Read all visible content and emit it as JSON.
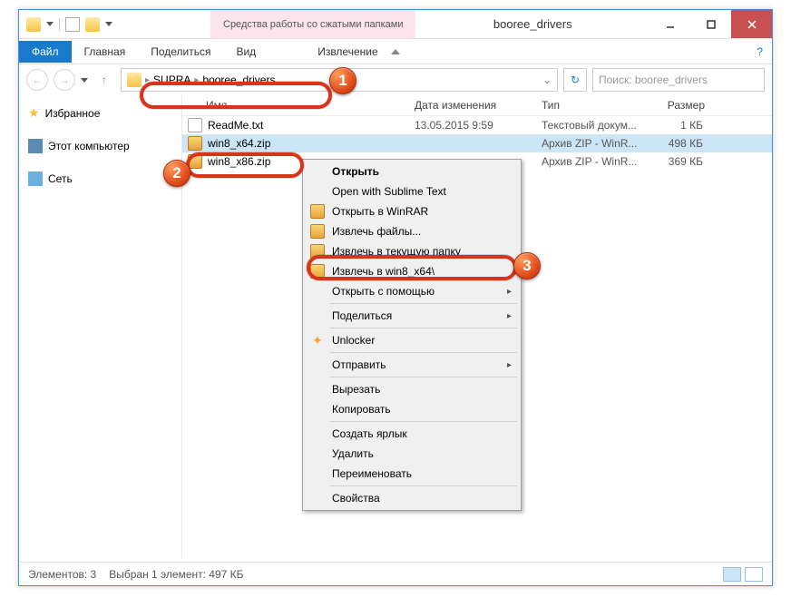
{
  "titlebar": {
    "tab": "Средства работы со сжатыми папками",
    "title": "booree_drivers"
  },
  "ribbon": {
    "file": "Файл",
    "tabs": [
      "Главная",
      "Поделиться",
      "Вид",
      "Извлечение"
    ]
  },
  "address": {
    "segs": [
      "SUPRA",
      "booree_drivers"
    ]
  },
  "search": {
    "placeholder": "Поиск: booree_drivers"
  },
  "nav": {
    "fav": "Избранное",
    "pc": "Этот компьютер",
    "net": "Сеть"
  },
  "cols": {
    "name": "Имя",
    "date": "Дата изменения",
    "type": "Тип",
    "size": "Размер"
  },
  "files": [
    {
      "name": "ReadMe.txt",
      "date": "13.05.2015 9:59",
      "type": "Текстовый докум...",
      "size": "1 КБ",
      "icon": "txt"
    },
    {
      "name": "win8_x64.zip",
      "date": "",
      "type": "Архив ZIP - WinR...",
      "size": "498 КБ",
      "icon": "zip",
      "sel": true
    },
    {
      "name": "win8_x86.zip",
      "date": "",
      "type": "Архив ZIP - WinR...",
      "size": "369 КБ",
      "icon": "zip"
    }
  ],
  "ctx": {
    "open": "Открыть",
    "sublime": "Open with Sublime Text",
    "winrar": "Открыть в WinRAR",
    "extract_files": "Извлечь файлы...",
    "extract_here": "Извлечь в текущую папку",
    "extract_to": "Извлечь в win8_x64\\",
    "open_with": "Открыть с помощью",
    "share": "Поделиться",
    "unlocker": "Unlocker",
    "send": "Отправить",
    "cut": "Вырезать",
    "copy": "Копировать",
    "shortcut": "Создать ярлык",
    "delete": "Удалить",
    "rename": "Переименовать",
    "props": "Свойства"
  },
  "status": {
    "count": "Элементов: 3",
    "sel": "Выбран 1 элемент: 497 КБ"
  },
  "badges": {
    "b1": "1",
    "b2": "2",
    "b3": "3"
  }
}
